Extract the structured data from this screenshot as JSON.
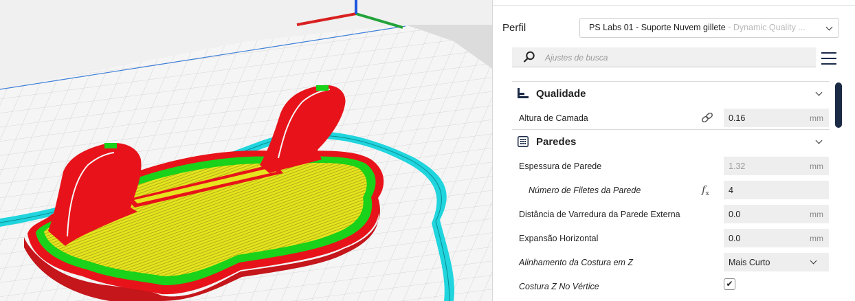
{
  "colors": {
    "accent_dark": "#1b2a45",
    "wall": "#e8131a",
    "infill": "#e6e41e",
    "skin": "#19d219",
    "skirt": "#20d5dd"
  },
  "viewport": {
    "icons": [
      "axis-gizmo"
    ]
  },
  "profile": {
    "label": "Perfil",
    "name": "PS Labs 01 - Suporte Nuvem gillete",
    "quality": " - Dynamic Quality ..."
  },
  "search": {
    "placeholder": "Ajustes de busca",
    "icon": "search-icon"
  },
  "menu": {
    "icon": "hamburger-menu-icon"
  },
  "categories": {
    "quality": {
      "title": "Qualidade",
      "icon": "quality-bars-icon"
    },
    "walls": {
      "title": "Paredes",
      "icon": "walls-grid-icon"
    }
  },
  "settings": {
    "layer_height": {
      "label": "Altura de Camada",
      "value": "0.16",
      "unit": "mm",
      "icon": "link-icon"
    },
    "wall_thickness": {
      "label": "Espessura de Parede",
      "value": "1.32",
      "unit": "mm"
    },
    "wall_line_count": {
      "label": "Número de Filetes da Parede",
      "value": "4",
      "icon": "function-icon"
    },
    "outer_wall_wipe": {
      "label": "Distância de Varredura da Parede Externa",
      "value": "0.0",
      "unit": "mm"
    },
    "horizontal_expansion": {
      "label": "Expansão Horizontal",
      "value": "0.0",
      "unit": "mm"
    },
    "z_seam_alignment": {
      "label": "Alinhamento da Costura em Z",
      "value": "Mais Curto"
    },
    "z_seam_on_vertex": {
      "label": "Costura Z No Vértice",
      "checked": true,
      "mark": "✔"
    }
  }
}
